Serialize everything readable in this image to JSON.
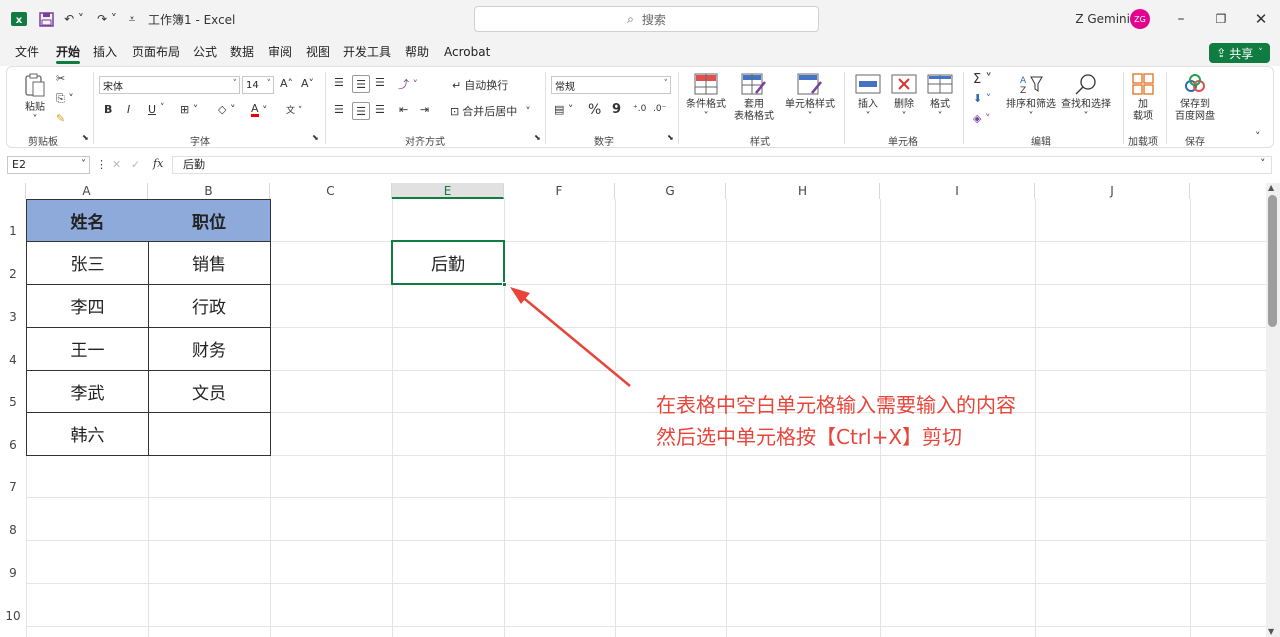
{
  "titlebar": {
    "doc_title": "工作簿1 - Excel",
    "search_placeholder": "搜索",
    "user_name": "Z Gemini",
    "avatar_initials": "ZG",
    "avatar_color": "#e3008c"
  },
  "menu": {
    "tabs": [
      "文件",
      "开始",
      "插入",
      "页面布局",
      "公式",
      "数据",
      "审阅",
      "视图",
      "开发工具",
      "帮助",
      "Acrobat"
    ],
    "active_tab": "开始",
    "share_label": "共享"
  },
  "ribbon": {
    "clipboard": {
      "paste": "粘贴",
      "group": "剪贴板"
    },
    "font": {
      "name": "宋体",
      "size": "14",
      "bold": "B",
      "italic": "I",
      "underline": "U",
      "group": "字体"
    },
    "alignment": {
      "wrap": "自动换行",
      "merge": "合并后居中",
      "group": "对齐方式"
    },
    "number": {
      "format": "常规",
      "percent": "%",
      "comma": "9",
      "group": "数字"
    },
    "styles": {
      "conditional": "条件格式",
      "table_format_1": "套用",
      "table_format_2": "表格格式",
      "cell_styles": "单元格样式",
      "group": "样式"
    },
    "cells": {
      "insert": "插入",
      "delete": "删除",
      "format": "格式",
      "group": "单元格"
    },
    "editing": {
      "sort_filter": "排序和筛选",
      "find_select": "查找和选择",
      "group": "编辑"
    },
    "addins": {
      "addins_1": "加",
      "addins_2": "载项",
      "group": "加载项"
    },
    "save": {
      "save_1": "保存到",
      "save_2": "百度网盘",
      "group": "保存"
    }
  },
  "formula_bar": {
    "name_box": "E2",
    "fx": "fx",
    "content": "后勤"
  },
  "sheet": {
    "columns": [
      "A",
      "B",
      "C",
      "E",
      "F",
      "G",
      "H",
      "I",
      "J"
    ],
    "selected_column": "E",
    "rows": [
      "1",
      "2",
      "3",
      "4",
      "5",
      "6",
      "7",
      "8",
      "9",
      "10"
    ],
    "selected_row": "2",
    "table": {
      "header": [
        "姓名",
        "职位"
      ],
      "rows": [
        [
          "张三",
          "销售"
        ],
        [
          "李四",
          "行政"
        ],
        [
          "王一",
          "财务"
        ],
        [
          "李武",
          "文员"
        ],
        [
          "韩六",
          ""
        ]
      ],
      "header_color": "#8eaadb"
    },
    "selected_cell_value": "后勤",
    "accent": "#107c41"
  },
  "annotation": {
    "line1": "在表格中空白单元格输入需要输入的内容",
    "line2": "然后选中单元格按【Ctrl+X】剪切",
    "color": "#e8443a"
  }
}
